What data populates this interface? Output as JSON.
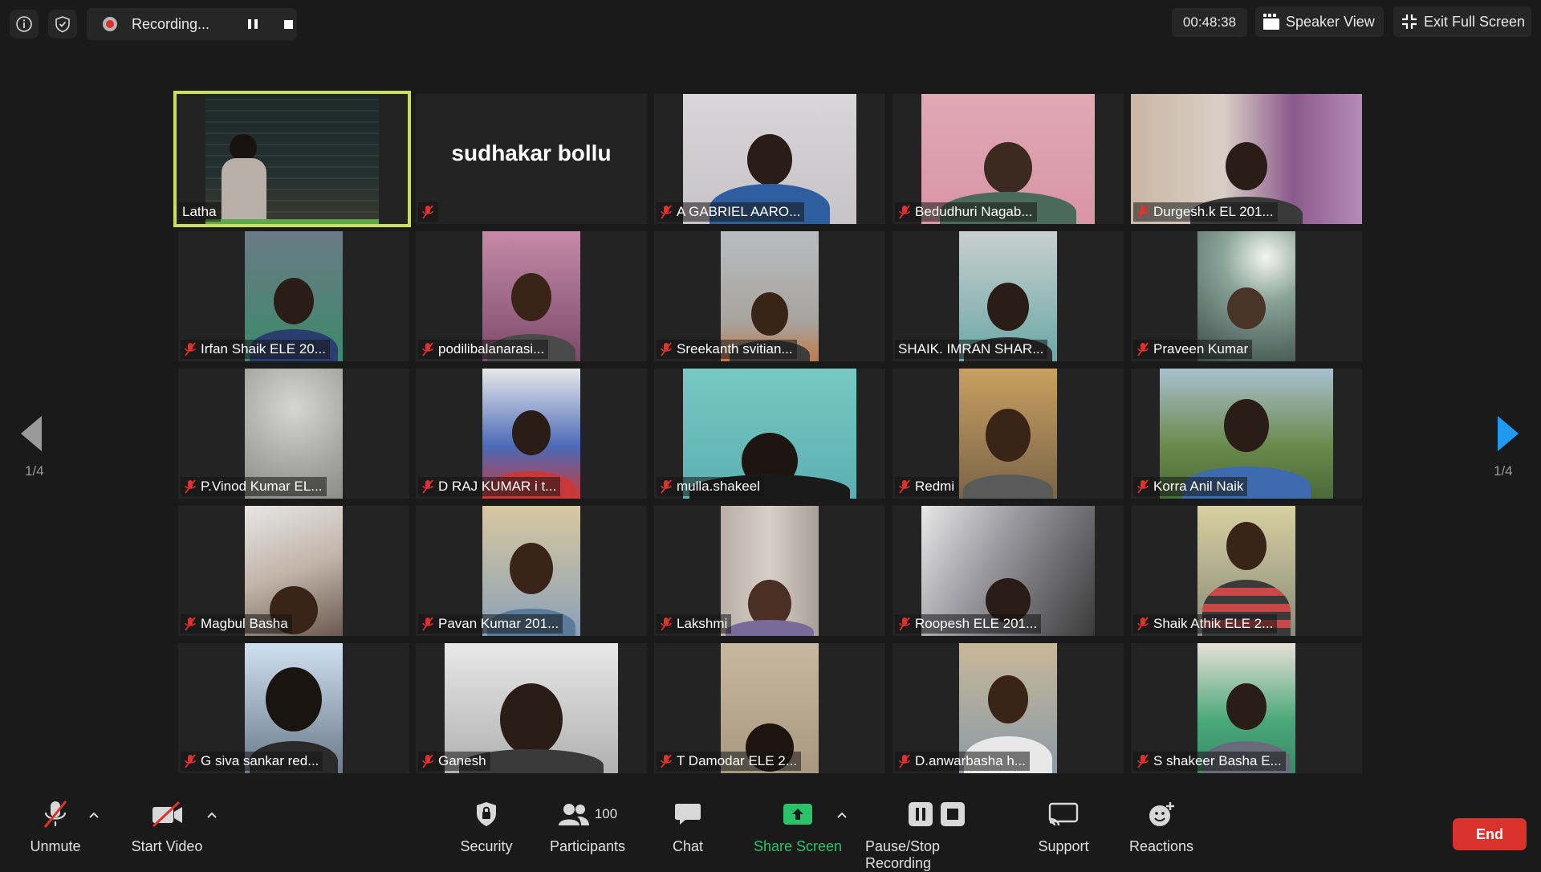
{
  "top_bar": {
    "recording_label": "Recording...",
    "timer": "00:48:38",
    "speaker_view_label": "Speaker View",
    "exit_fullscreen_label": "Exit Full Screen"
  },
  "gallery": {
    "page_indicator_left": "1/4",
    "page_indicator_right": "1/4",
    "tiles": [
      {
        "name": "Latha",
        "muted": false,
        "video": true,
        "active": true
      },
      {
        "name": "sudhakar bollu",
        "muted": true,
        "video": false,
        "active": false
      },
      {
        "name": "A GABRIEL AARO...",
        "muted": true,
        "video": true
      },
      {
        "name": "Bedudhuri Nagab...",
        "muted": true,
        "video": true
      },
      {
        "name": "Durgesh.k EL 201...",
        "muted": true,
        "video": true
      },
      {
        "name": "Irfan Shaik ELE 20...",
        "muted": true,
        "video": true
      },
      {
        "name": "podilibalanarasi...",
        "muted": true,
        "video": true
      },
      {
        "name": "Sreekanth svitian...",
        "muted": true,
        "video": true
      },
      {
        "name": "SHAIK. IMRAN SHAR...",
        "muted": false,
        "video": true
      },
      {
        "name": "Praveen Kumar",
        "muted": true,
        "video": true
      },
      {
        "name": "P.Vinod Kumar EL...",
        "muted": true,
        "video": true
      },
      {
        "name": "D RAJ KUMAR   i t...",
        "muted": true,
        "video": true
      },
      {
        "name": "mulla.shakeel",
        "muted": true,
        "video": true
      },
      {
        "name": "Redmi",
        "muted": true,
        "video": true
      },
      {
        "name": "Korra Anil Naik",
        "muted": true,
        "video": true
      },
      {
        "name": "Magbul Basha",
        "muted": true,
        "video": true
      },
      {
        "name": "Pavan Kumar 201...",
        "muted": true,
        "video": true
      },
      {
        "name": "Lakshmi",
        "muted": true,
        "video": true
      },
      {
        "name": "Roopesh ELE  201...",
        "muted": true,
        "video": true
      },
      {
        "name": "Shaik Athik ELE 2...",
        "muted": true,
        "video": true
      },
      {
        "name": "G siva sankar red...",
        "muted": true,
        "video": true
      },
      {
        "name": "Ganesh",
        "muted": true,
        "video": true
      },
      {
        "name": "T Damodar ELE  2...",
        "muted": true,
        "video": true
      },
      {
        "name": "D.anwarbasha   h...",
        "muted": true,
        "video": true
      },
      {
        "name": "S shakeer Basha E...",
        "muted": true,
        "video": true
      }
    ]
  },
  "toolbar": {
    "unmute": "Unmute",
    "start_video": "Start Video",
    "security": "Security",
    "participants": "Participants",
    "participants_count": "100",
    "chat": "Chat",
    "share_screen": "Share Screen",
    "pause_stop_recording": "Pause/Stop Recording",
    "support": "Support",
    "reactions": "Reactions",
    "end": "End"
  },
  "colors": {
    "background": "#1a1a1a",
    "tile_background": "#232323",
    "active_speaker_border": "#cbe05a",
    "mute_red": "#e0312b",
    "share_green": "#29c46a",
    "end_red": "#d9312c",
    "nav_arrow_blue": "#1e9bf0"
  }
}
